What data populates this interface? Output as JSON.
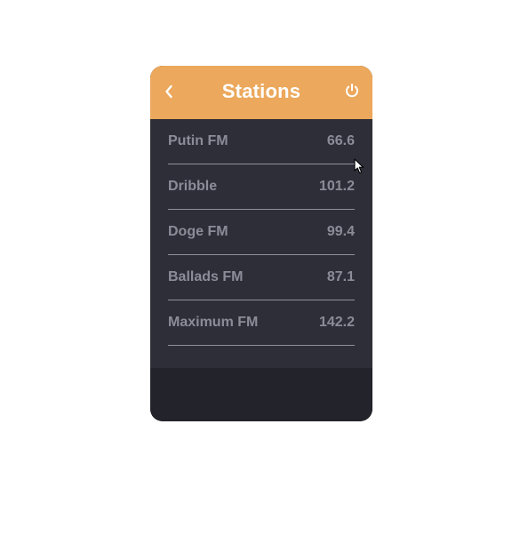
{
  "header": {
    "title": "Stations",
    "back_icon": "chevron-left-icon",
    "power_icon": "power-icon"
  },
  "stations": [
    {
      "name": "Putin FM",
      "frequency": "66.6"
    },
    {
      "name": "Dribble",
      "frequency": "101.2"
    },
    {
      "name": "Doge FM",
      "frequency": "99.4"
    },
    {
      "name": "Ballads FM",
      "frequency": "87.1"
    },
    {
      "name": "Maximum FM",
      "frequency": "142.2"
    }
  ],
  "colors": {
    "header_bg": "#eca85c",
    "list_bg": "#2e2e38",
    "footer_bg": "#23232b",
    "text_muted": "#8a8c98"
  }
}
